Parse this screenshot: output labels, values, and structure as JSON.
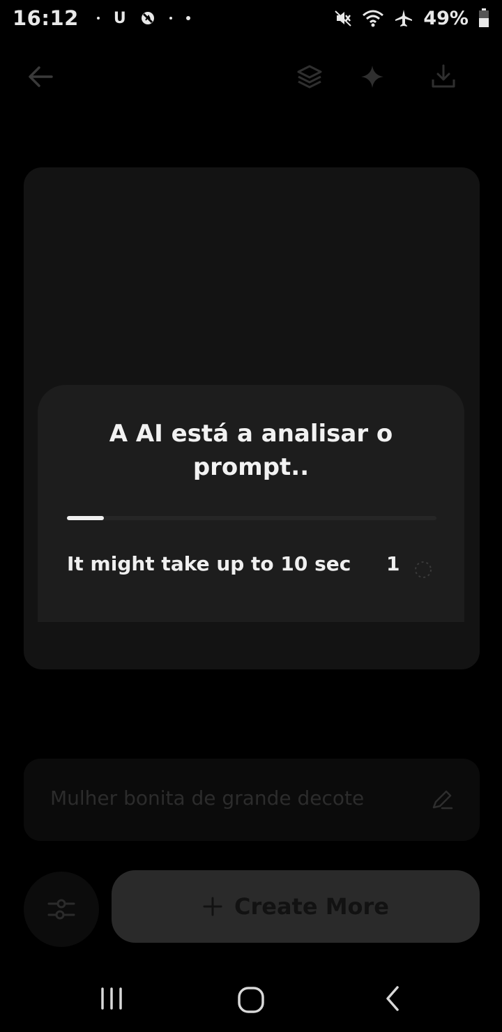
{
  "status_bar": {
    "time": "16:12",
    "left_badge": "U",
    "battery_percent": "49%"
  },
  "icons": {
    "back": "arrow-left-icon",
    "layers": "layers-icon",
    "sparkle": "sparkle-icon",
    "download": "download-icon",
    "edit": "pencil-icon",
    "settings": "sliders-icon",
    "plus": "plus-icon"
  },
  "dialog": {
    "title": "A AI está a analisar o prompt..",
    "progress_fraction": 0.1,
    "hint": "It might take up to 10 sec",
    "count": "1"
  },
  "prompt": {
    "text": "Mulher bonita de grande decote"
  },
  "actions": {
    "create_more_label": "Create More"
  },
  "colors": {
    "background": "#000000",
    "dialog": "#1d1d1d",
    "card": "#131313",
    "progress": "#f0f0f0"
  }
}
